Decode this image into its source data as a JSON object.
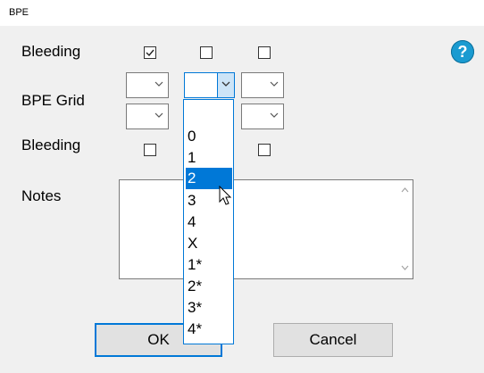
{
  "window": {
    "title": "BPE"
  },
  "labels": {
    "bleeding_top": "Bleeding",
    "bpe_grid": "BPE Grid",
    "bleeding_bottom": "Bleeding",
    "notes": "Notes"
  },
  "checkboxes": {
    "top": [
      {
        "checked": true
      },
      {
        "checked": false
      },
      {
        "checked": false
      }
    ],
    "bottom": [
      {
        "checked": false
      },
      {
        "checked": false
      }
    ]
  },
  "grid_combos": {
    "row1": [
      "",
      "",
      ""
    ],
    "row2": [
      "",
      ""
    ]
  },
  "dropdown": {
    "options": [
      "0",
      "1",
      "2",
      "3",
      "4",
      "X",
      "1*",
      "2*",
      "3*",
      "4*"
    ],
    "selected_index": 2
  },
  "notes": {
    "value": ""
  },
  "buttons": {
    "ok": "OK",
    "cancel": "Cancel"
  },
  "help": {
    "glyph": "?",
    "icon": "help-icon",
    "color": "#1a9bd1"
  },
  "accent_color": "#0078d7"
}
